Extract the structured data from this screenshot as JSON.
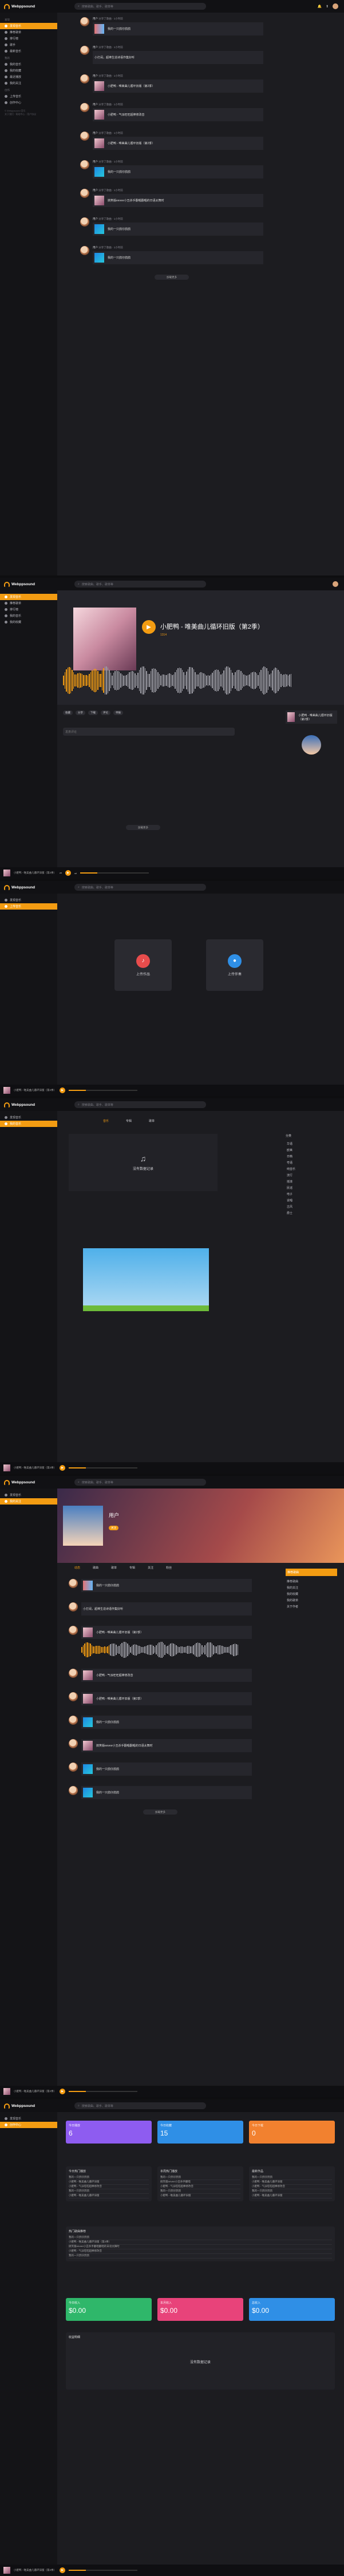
{
  "app": {
    "logo_text": "Webppsound",
    "logo_accent": "sound",
    "search_placeholder": "搜索歌曲、歌手、歌单等",
    "header_user": "用户"
  },
  "sidebar": {
    "sections": [
      {
        "title": "发现",
        "items": [
          "发现音乐",
          "推荐歌单",
          "排行榜",
          "歌手",
          "最新音乐"
        ]
      },
      {
        "title": "我的",
        "items": [
          "我的音乐",
          "我的收藏",
          "最近播放",
          "我的关注"
        ]
      },
      {
        "title": "创作",
        "items": [
          "上传音乐",
          "创作中心"
        ]
      }
    ],
    "footer": "© Webppsound 音乐\n关于我们 · 帮助中心 · 用户协议"
  },
  "feed": {
    "posts": [
      {
        "user": "用户",
        "action": "分享了歌曲",
        "time": "1小时前",
        "text": "",
        "card": "我的一只鸽仔鸽鸽",
        "thumb": "pill"
      },
      {
        "user": "用户",
        "action": "分享了歌曲",
        "time": "1小时前",
        "text": "小打闹，超棒生造诗语作集好听",
        "card": "",
        "thumb": ""
      },
      {
        "user": "用户",
        "action": "分享了歌曲",
        "time": "1小时前",
        "text": "",
        "card": "小肥鸭 - 唯美曲儿循环旧版（第2季）",
        "thumb": "girl"
      },
      {
        "user": "用户",
        "action": "分享了歌曲",
        "time": "1小时前",
        "text": "",
        "card": "小肥鸭 - 气派旺旺超棒修改音",
        "thumb": "girl"
      },
      {
        "user": "用户",
        "action": "分享了歌曲",
        "time": "1小时前",
        "text": "",
        "card": "小肥鸭 - 唯美曲儿循环旧版（第2季）",
        "thumb": "girl"
      },
      {
        "user": "用户",
        "action": "分享了歌曲",
        "time": "1小时前",
        "text": "",
        "card": "我的一只鸽仔鸽鸽",
        "thumb": "fish"
      },
      {
        "user": "用户",
        "action": "分享了歌曲",
        "time": "1小时前",
        "text": "",
        "card": "搞笑版eevee小丑杀手翻唱翻唱的日语太舞时",
        "thumb": "girl"
      },
      {
        "user": "用户",
        "action": "分享了歌曲",
        "time": "1小时前",
        "text": "",
        "card": "我的一只鸽仔鸽鸽",
        "thumb": "fish"
      },
      {
        "user": "用户",
        "action": "分享了歌曲",
        "time": "1小时前",
        "text": "",
        "card": "我的一只鸽仔鸽鸽",
        "thumb": "fish"
      }
    ],
    "more_label": "加载更多"
  },
  "player": {
    "title": "小肥鸭 - 唯美曲儿循环旧版（第2季）",
    "artist": "用户",
    "play_icon": "play-icon",
    "progress": 0.25
  },
  "song_page": {
    "title": "小肥鸭 - 唯美曲儿循环旧版（第2季）",
    "play_count": "1314",
    "comments_title": "评论",
    "comment_placeholder": "发表评论",
    "more_label": "加载更多",
    "actions": [
      "收藏",
      "分享",
      "下载",
      "评论",
      "举报"
    ]
  },
  "upload_page": {
    "btn1": "上传作品",
    "btn2": "上传伴奏"
  },
  "music_page": {
    "tabs": [
      "音乐",
      "专辑",
      "歌单"
    ],
    "empty": "没有数据记录",
    "right_title": "分类",
    "right_items": [
      "华语",
      "欧美",
      "日韩",
      "粤语",
      "纯音乐",
      "流行",
      "摇滚",
      "民谣",
      "电子",
      "说唱",
      "古风",
      "爵士"
    ]
  },
  "profile_page": {
    "name": "用户",
    "tabs": [
      "动态",
      "歌曲",
      "歌单",
      "专辑",
      "关注",
      "粉丝"
    ],
    "follow": "关注",
    "right_title": "推荐歌曲",
    "right_items": [
      "推荐歌曲",
      "我的关注",
      "我的收藏",
      "我的歌单",
      "关于作者"
    ]
  },
  "dashboard": {
    "stats": [
      {
        "label": "今日播放",
        "value": "6",
        "color": "#8e5cf0"
      },
      {
        "label": "今日收藏",
        "value": "15",
        "color": "#2f8fe6"
      },
      {
        "label": "今日下载",
        "value": "0",
        "color": "#f2812f"
      }
    ],
    "lists": [
      {
        "title": "今日热门播放",
        "items": [
          "我的一只鸽仔鸽鸽",
          "小肥鸭 - 唯美曲儿循环旧版",
          "小肥鸭 - 气派旺旺超棒修改音",
          "我的一只鸽仔鸽鸽",
          "小肥鸭 - 唯美曲儿循环旧版"
        ]
      },
      {
        "title": "本周热门播放",
        "items": [
          "我的一只鸽仔鸽鸽",
          "搞笑版eevee小丑杀手翻唱",
          "小肥鸭 - 气派旺旺超棒修改音",
          "我的一只鸽仔鸽鸽",
          "小肥鸭 - 唯美曲儿循环旧版"
        ]
      },
      {
        "title": "最新作品",
        "items": [
          "我的一只鸽仔鸽鸽",
          "小肥鸭 - 唯美曲儿循环旧版",
          "小肥鸭 - 气派旺旺超棒修改音",
          "我的一只鸽仔鸽鸽",
          "小肥鸭 - 唯美曲儿循环旧版"
        ]
      }
    ],
    "list_wide": {
      "title": "热门歌曲推荐",
      "items": [
        "我的一只鸽仔鸽鸽",
        "小肥鸭 - 唯美曲儿循环旧版（第2季）",
        "搞笑版eevee小丑杀手翻唱翻唱的日语太舞时",
        "小肥鸭 - 气派旺旺超棒修改音",
        "我的一只鸽仔鸽鸽"
      ]
    },
    "money": [
      {
        "label": "今日收入",
        "value": "$0.00",
        "color": "#2fb76a"
      },
      {
        "label": "本月收入",
        "value": "$0.00",
        "color": "#e8437a"
      },
      {
        "label": "总收入",
        "value": "$0.00",
        "color": "#2f8fe6"
      }
    ],
    "bottom_title": "收益明细",
    "bottom_empty": "没有数据记录"
  }
}
